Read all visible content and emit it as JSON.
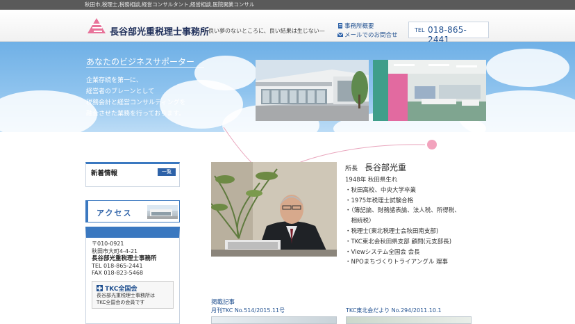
{
  "topbar": {
    "text": "秋田市,税理士,税務相談,経営コンサルタント,経営相談,医院開業コンサル"
  },
  "header": {
    "logo_name": "長谷部光重税理士事務所",
    "tagline": "—良い夢のないところに、良い結果は生じない—",
    "link_about": "事務所概要",
    "link_contact": "メールでのお問合せ",
    "tel_prefix": "TEL",
    "tel_number": "018-865-2441"
  },
  "hero": {
    "title": "あなたのビジネスサポーター",
    "lines": [
      "企業存続を第一に、",
      "経営者のブレーンとして",
      "税務会計と経営コンサルティングを",
      "融合させた業務を行っております。"
    ]
  },
  "sidebar": {
    "news_title": "新着情報",
    "news_button": "一覧",
    "access_title": "アクセス",
    "postal": "〒010-0921",
    "address": "秋田市大町4-4-21",
    "office_name": "長谷部光重税理士事務所",
    "tel": "TEL 018-865-2441",
    "fax": "FAX 018-823-5468",
    "tkc_logo": "TKC全国会",
    "tkc_note_1": "長谷部光重税理士事務所は",
    "tkc_note_2": "TKC全国会の会員です"
  },
  "profile": {
    "role": "所長",
    "name": "長谷部光重",
    "lines": [
      "1948年 秋田県生れ",
      "・秋田高校、中央大学卒業",
      "・1975年税理士試験合格",
      "・（簿記論、財務諸表論、法人税、所得税、",
      "　相続税）",
      "・税理士(東北税理士会秋田南支部)",
      "・TKC東北会秋田県支部 顧問(元支部長)",
      "・Viewシステム全国会 会長",
      "・NPOまちづくりトライアングル 理事"
    ]
  },
  "articles": {
    "title": "掲載記事",
    "item1": "月刊TKC No.514/2015.11号",
    "item2": "TKC東北会だより No.294/2011.10.1"
  },
  "colors": {
    "accent_blue": "#3a78c0",
    "link_blue": "#1f4f8f",
    "logo_pink": "#e8739a",
    "dot_pink": "#f2a3bd"
  }
}
